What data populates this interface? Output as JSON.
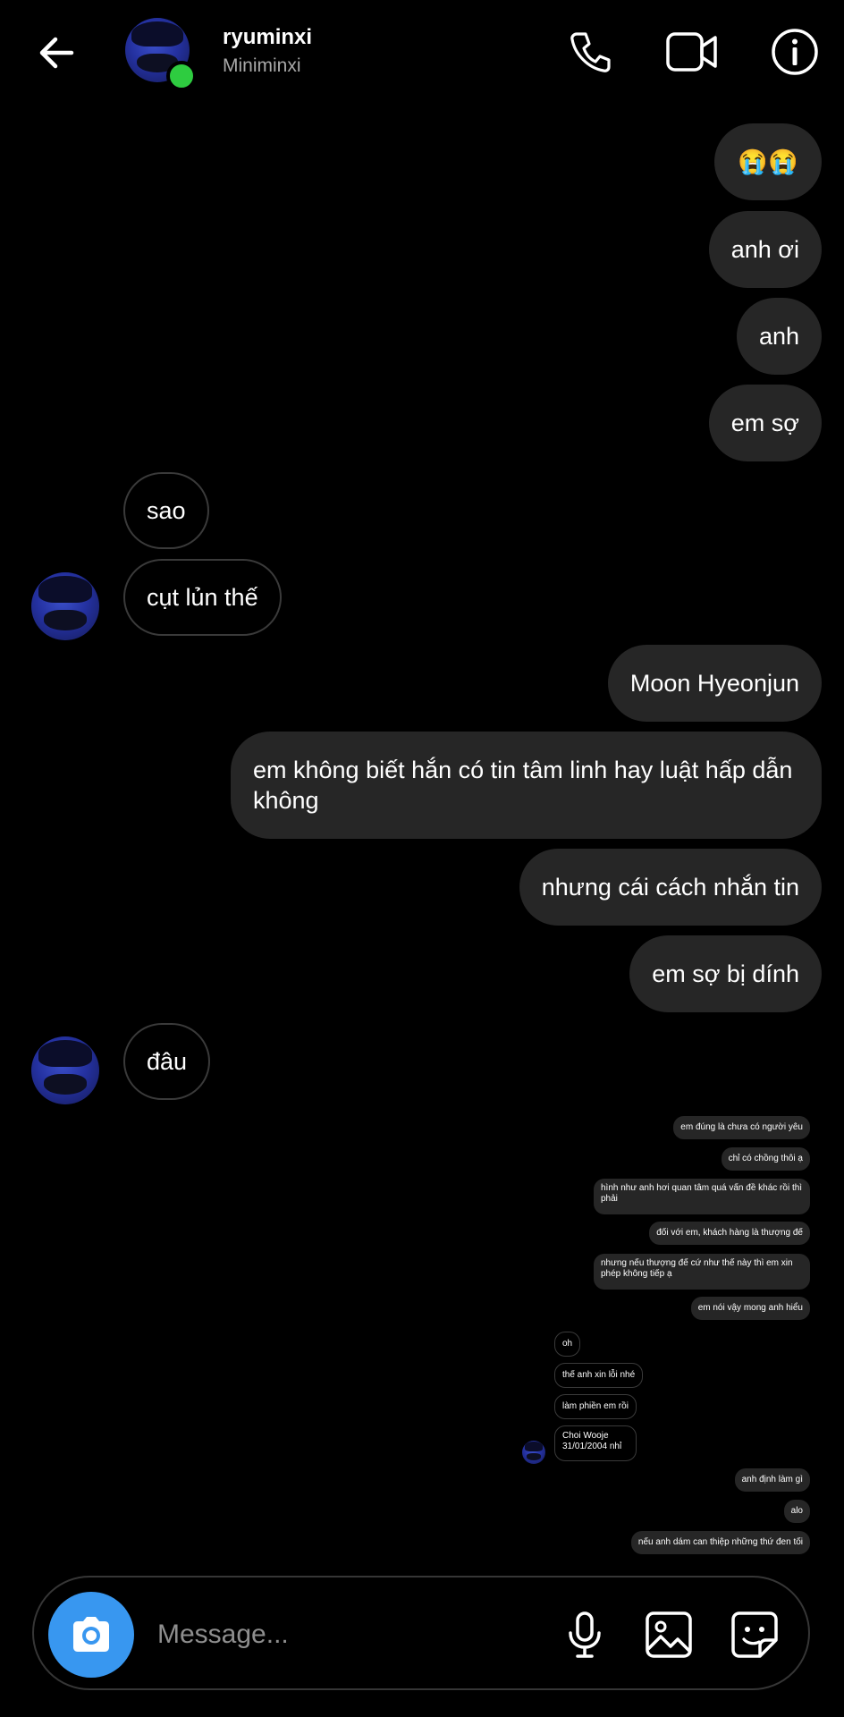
{
  "header": {
    "username": "ryuminxi",
    "subtitle": "Miniminxi",
    "back_icon": "arrow-left-icon",
    "call_icon": "phone-icon",
    "video_icon": "video-camera-icon",
    "info_icon": "info-icon",
    "online_color": "#2ecc40"
  },
  "messages": [
    {
      "side": "out",
      "text": "😭😭"
    },
    {
      "side": "out",
      "text": "anh ơi"
    },
    {
      "side": "out",
      "text": "anh"
    },
    {
      "side": "out",
      "text": "em sợ"
    },
    {
      "side": "in",
      "text": "sao"
    },
    {
      "side": "in",
      "text": "cụt lủn thế"
    },
    {
      "side": "out",
      "text": "Moon Hyeonjun"
    },
    {
      "side": "out",
      "text": "em không biết hắn có tin tâm linh hay luật hấp dẫn không"
    },
    {
      "side": "out",
      "text": "nhưng cái cách nhắn tin"
    },
    {
      "side": "out",
      "text": "em sợ bị dính"
    },
    {
      "side": "in",
      "text": "đâu"
    }
  ],
  "shared_screenshot": {
    "messages": [
      {
        "side": "out",
        "text": "em đúng là chưa có người yêu"
      },
      {
        "side": "out",
        "text": "chỉ có chồng thôi ạ"
      },
      {
        "side": "out",
        "text": "hình như anh hơi quan tâm quá vấn đề khác rồi thì phải"
      },
      {
        "side": "out",
        "text": "đối với em, khách hàng là thượng đế"
      },
      {
        "side": "out",
        "text": "nhưng nếu thượng đế cứ như thế này thì em xin phép không tiếp ạ"
      },
      {
        "side": "out",
        "text": "em nói vậy mong anh hiểu"
      },
      {
        "side": "in",
        "text": "oh"
      },
      {
        "side": "in",
        "text": "thế anh xin lỗi nhé"
      },
      {
        "side": "in",
        "text": "làm phiền em rồi"
      },
      {
        "side": "in",
        "text": "Choi Wooje 31/01/2004 nhỉ"
      },
      {
        "side": "out",
        "text": "anh định làm gì"
      },
      {
        "side": "out",
        "text": "alo"
      },
      {
        "side": "out",
        "text": "nếu anh dám can thiệp những thứ đen tối"
      }
    ]
  },
  "composer": {
    "placeholder": "Message...",
    "camera_icon": "camera-icon",
    "mic_icon": "microphone-icon",
    "gallery_icon": "image-icon",
    "sticker_icon": "sticker-icon",
    "camera_color": "#3897f0"
  }
}
